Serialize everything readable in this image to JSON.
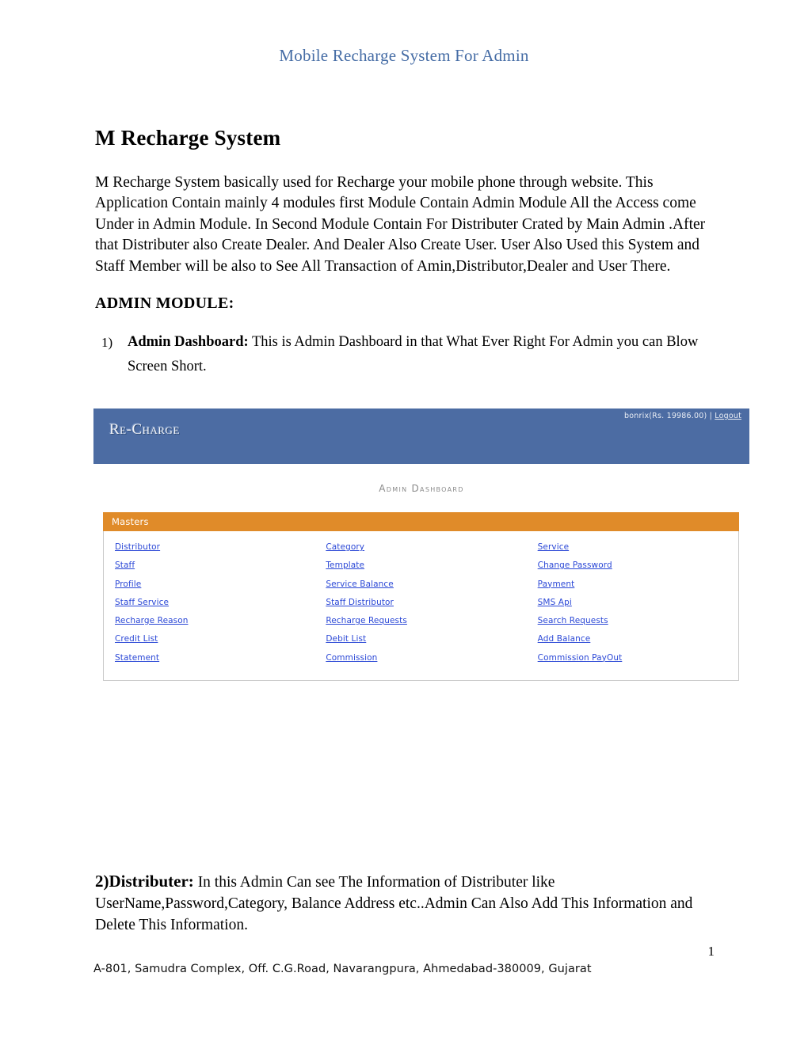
{
  "document": {
    "running_header": "Mobile Recharge System For Admin",
    "title": "M Recharge System",
    "intro_paragraph": "M Recharge System basically used for Recharge your mobile phone through website. This Application Contain mainly 4 modules first Module Contain Admin Module All the Access come Under in Admin Module. In Second Module Contain For Distributer Crated by Main Admin .After that Distributer also Create Dealer. And Dealer Also Create User. User Also Used this System and Staff Member will be also to See All Transaction of Amin,Distributor,Dealer and User There.",
    "section_heading": "ADMIN MODULE:",
    "list_item_1": {
      "marker": "1)",
      "lead": "Admin Dashboard:",
      "text": " This is Admin Dashboard in that What Ever Right For Admin you can Blow Screen Short."
    },
    "section_2": {
      "lead": "2)Distributer:",
      "text": " In this Admin Can see The Information of  Distributer like UserName,Password,Category, Balance Address etc..Admin Can Also Add This Information and Delete This Information."
    },
    "page_number": "1",
    "footer_address": "A-801, Samudra Complex, Off. C.G.Road, Navarangpura, Ahmedabad-380009, Gujarat"
  },
  "screenshot": {
    "logo_text": "Re-Charge",
    "user_info": "bonrix(Rs. 19986.00) |",
    "logout_label": "Logout",
    "dashboard_title": "Admin Dashboard",
    "panel_title": "Masters",
    "columns": [
      {
        "links": [
          "Distributor",
          "Staff",
          "Profile",
          "Staff Service",
          "Recharge Reason",
          "Credit List",
          "Statement"
        ]
      },
      {
        "links": [
          "Category",
          "Template",
          "Service Balance",
          "Staff Distributor",
          "Recharge Requests",
          "Debit List",
          "Commission"
        ]
      },
      {
        "links": [
          "Service",
          "Change Password",
          "Payment",
          "SMS Api",
          "Search Requests",
          "Add Balance",
          "Commission PayOut"
        ]
      }
    ]
  },
  "colors": {
    "header_blue": "#456ca5",
    "app_topbar_blue": "#4c6ca3",
    "panel_orange": "#e08b29",
    "link_blue": "#2a47d6"
  }
}
